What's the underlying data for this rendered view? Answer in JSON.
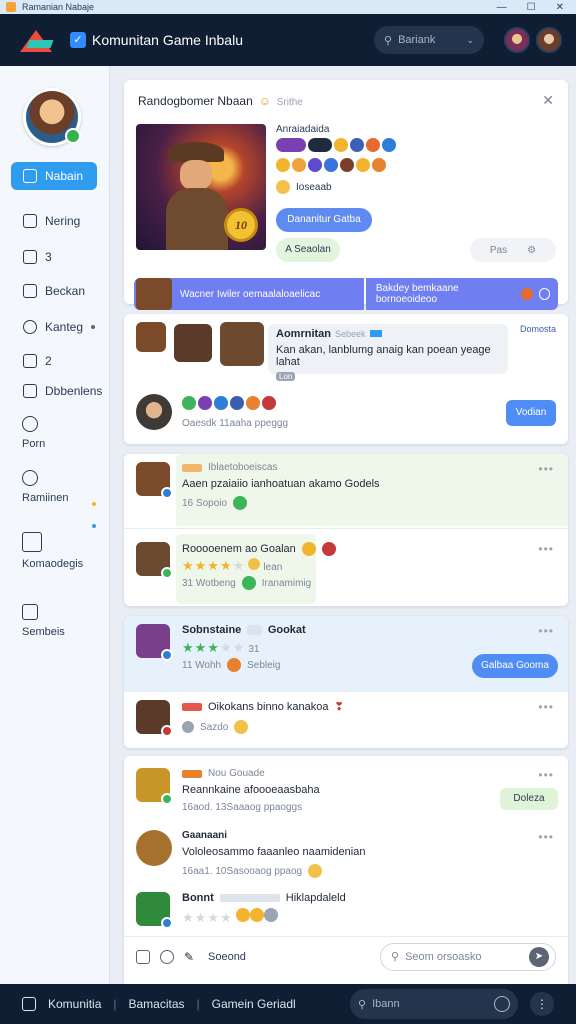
{
  "titlebar": {
    "title": "Ramanian Nabaje",
    "controls": [
      "—",
      "☐",
      "✕"
    ]
  },
  "header": {
    "title": "Komunitan Game Inbalu",
    "search_label": "Bariank"
  },
  "sidebar": {
    "items": [
      {
        "label": "Nabain",
        "active": true
      },
      {
        "label": "Nering"
      },
      {
        "label": "3"
      },
      {
        "label": "Beckan"
      },
      {
        "label": "Kanteg"
      },
      {
        "label": "2"
      },
      {
        "label": "Dbbenlens"
      }
    ],
    "stack": [
      {
        "label": "Porn"
      },
      {
        "label": "Ramiinen"
      },
      {
        "label": "Komaodegis"
      },
      {
        "label": "Sembeis"
      }
    ]
  },
  "promo": {
    "title": "Randogbomer Nbaan",
    "subtitle": "Srithe",
    "label": "Anraiadaida",
    "badge": "Ioseaab",
    "primary_button": "Dananitur Gatba",
    "secondary_button": "A Seaolan",
    "pill": "Pas",
    "coin": "10",
    "strip_left": "Wacner Iwiler oemaalaloaelicac",
    "strip_right": "Bakdey bemkaane bornoeoideoo"
  },
  "announcement": {
    "title": "Aomrnitan",
    "tag": "Sebeek",
    "message": "Kan akan, lanblumg anaig kan poean yeage lahat",
    "chip": "Lon",
    "right_label": "Domosta",
    "stat": "Oaesdk 11aaha ppeggg",
    "button": "Vodian"
  },
  "feed": [
    {
      "meta": "Iblaetoboeiscas",
      "text": "Aaen pzaiaiio ianhoatuan akamo Godels",
      "stat": "16 Sopoio",
      "more": "•••"
    },
    {
      "meta": "",
      "text": "Rooooenem ao Goalan",
      "stat": "31 Wotbeng",
      "stat2": "Iranamimig",
      "rating_note": "lean",
      "more": "•••"
    },
    {
      "meta": "",
      "text": "Sobnstaine",
      "tag": "Gookat",
      "stat": "11 Wohh",
      "stat2": "Sebleig",
      "rating_note": "31",
      "button": "Galbaa Gooma",
      "more": "•••"
    },
    {
      "meta": "",
      "text": "Oikokans binno kanakoa",
      "stat": "Sazdo",
      "more": "•••"
    },
    {
      "meta": "Nou Gouade",
      "text": "Reannkaine afoooeaasbaha",
      "stat": "16aod. 13Saaaog ppaoggs",
      "badge": "Doleza",
      "more": "•••"
    },
    {
      "meta": "Gaanaani",
      "text": "Vololeosammo faaanleo naamidenian",
      "stat": "16aa1. 10Sasooaog ppaog",
      "more": "•••"
    },
    {
      "meta": "Bonnt",
      "text": "Hiklapdaleld",
      "more": ""
    }
  ],
  "composer": {
    "label": "Soeond",
    "placeholder": "Seom orsoasko"
  },
  "bottombar": {
    "item1": "Komunitia",
    "item2": "Bamacitas",
    "item3": "Gamein Geriadl",
    "search": "Ibann"
  },
  "colors": {
    "header": "#0f1e33",
    "accent": "#2f9cf0",
    "button": "#4f8df5",
    "strip": "#6f7ef0"
  },
  "icons": [
    "search-icon",
    "chevron-down-icon",
    "close-icon",
    "home-icon",
    "edit-icon",
    "gear-icon",
    "send-icon",
    "more-icon"
  ]
}
